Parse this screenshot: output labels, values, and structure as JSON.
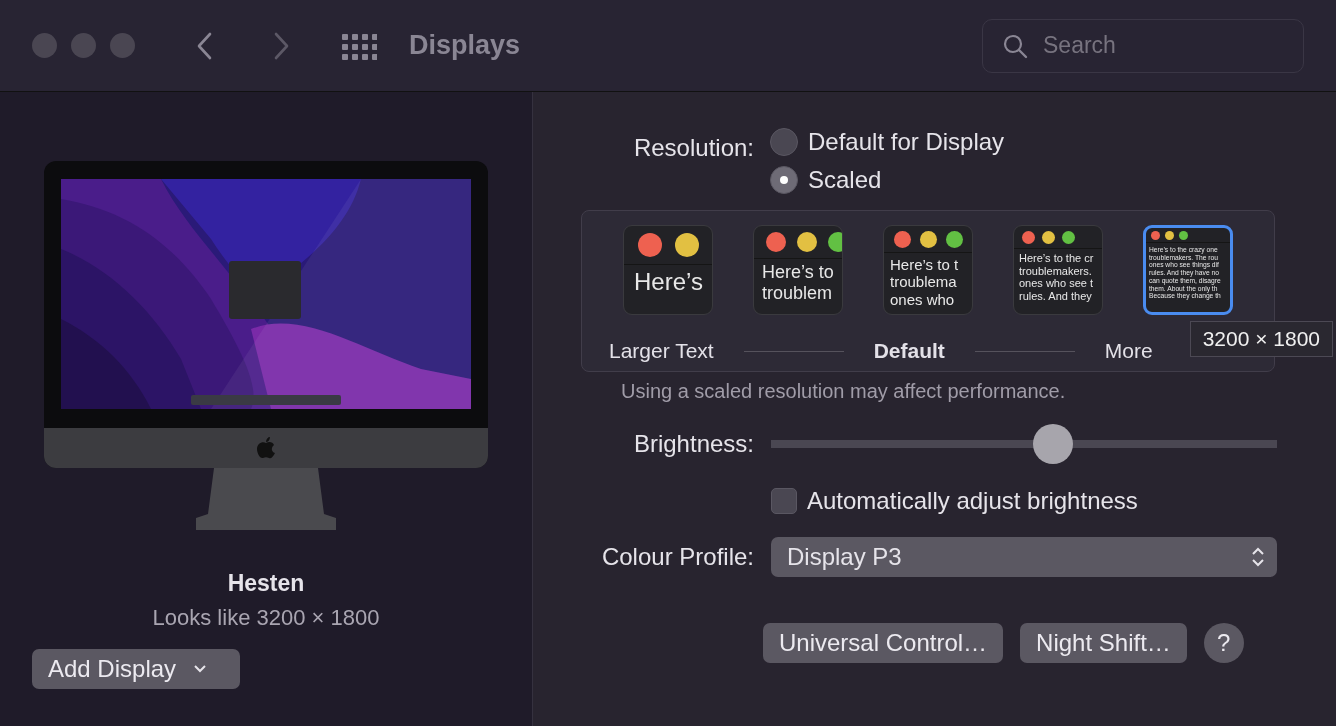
{
  "window": {
    "title": "Displays",
    "search": {
      "placeholder": "Search"
    }
  },
  "display": {
    "name": "Hesten",
    "resolution_note": "Looks like 3200 × 1800",
    "add_button": "Add Display"
  },
  "resolution": {
    "label": "Resolution:",
    "options": [
      {
        "label": "Default for Display",
        "selected": false
      },
      {
        "label": "Scaled",
        "selected": true
      }
    ]
  },
  "scale_options": [
    {
      "selected": false,
      "lines": [
        "Here’s"
      ]
    },
    {
      "selected": false,
      "lines": [
        "Here’s to",
        "troublem"
      ]
    },
    {
      "selected": false,
      "lines": [
        "Here’s to t",
        "troublema",
        "ones who"
      ]
    },
    {
      "selected": false,
      "lines": [
        "Here’s to the cr",
        "troublemakers.",
        "ones who see t",
        "rules. And they"
      ]
    },
    {
      "selected": true,
      "lines": [
        "Here’s to the crazy one",
        "troublemakers. The rou",
        "ones who see things dif",
        "rules. And they have no",
        "can quote them, disagre",
        "them. About the only th",
        "Because they change th"
      ]
    }
  ],
  "scale_labels": [
    "Larger Text",
    "Default",
    "More"
  ],
  "tooltip": "3200 × 1800",
  "performance_note": "Using a scaled resolution may affect performance.",
  "brightness": {
    "label": "Brightness:",
    "level": 0.557
  },
  "auto_brightness": {
    "label": "Automatically adjust brightness",
    "checked": false
  },
  "colour_profile": {
    "label": "Colour Profile:",
    "value": "Display P3"
  },
  "buttons": [
    "Universal Control…",
    "Night Shift…"
  ],
  "help": "?"
}
